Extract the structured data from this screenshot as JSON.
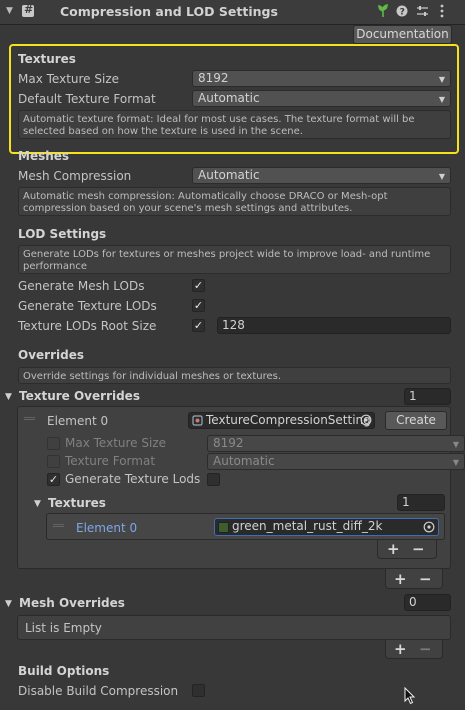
{
  "header": {
    "title": "Compression and LOD Settings",
    "expand_arrow": "chevron-down-icon",
    "icons": [
      "component-icon",
      "plant-icon",
      "help-icon",
      "sliders-icon",
      "kebab-icon"
    ]
  },
  "documentation_button": "Documentation",
  "textures": {
    "heading": "Textures",
    "max_size_label": "Max Texture Size",
    "max_size_value": "8192",
    "format_label": "Default Texture Format",
    "format_value": "Automatic",
    "help": "Automatic texture format: Ideal for most use cases. The texture format will be selected based on how the texture is used in the scene."
  },
  "meshes": {
    "heading": "Meshes",
    "compression_label": "Mesh Compression",
    "compression_value": "Automatic",
    "help": "Automatic mesh compression: Automatically choose DRACO or Mesh-opt compression based on your scene's mesh settings and attributes."
  },
  "lod": {
    "heading": "LOD Settings",
    "help": "Generate LODs for textures or meshes project wide to improve load- and runtime performance",
    "gen_mesh_label": "Generate Mesh LODs",
    "gen_mesh_checked": true,
    "gen_tex_label": "Generate Texture LODs",
    "gen_tex_checked": true,
    "root_size_label": "Texture LODs Root Size",
    "root_size_checked": true,
    "root_size_value": "128"
  },
  "overrides": {
    "heading": "Overrides",
    "help": "Override settings for individual meshes or textures."
  },
  "texture_overrides": {
    "label": "Texture Overrides",
    "count": "1",
    "element_label": "Element 0",
    "element_value": "TextureCompressionSetting",
    "create_button": "Create",
    "max_size_label": "Max Texture Size",
    "max_size_value": "8192",
    "format_label": "Texture Format",
    "format_value": "Automatic",
    "gen_lods_label": "Generate Texture Lods",
    "textures_label": "Textures",
    "textures_count": "1",
    "tex_element_label": "Element 0",
    "tex_element_value": "green_metal_rust_diff_2k",
    "add": "+",
    "remove": "−"
  },
  "mesh_overrides": {
    "label": "Mesh Overrides",
    "count": "0",
    "empty": "List is Empty",
    "add": "+",
    "remove": "−"
  },
  "build": {
    "heading": "Build Options",
    "disable_label": "Disable Build Compression"
  },
  "colors": {
    "background": "#383838",
    "highlight": "#f5e21a",
    "link_label": "#7fa6e8"
  }
}
